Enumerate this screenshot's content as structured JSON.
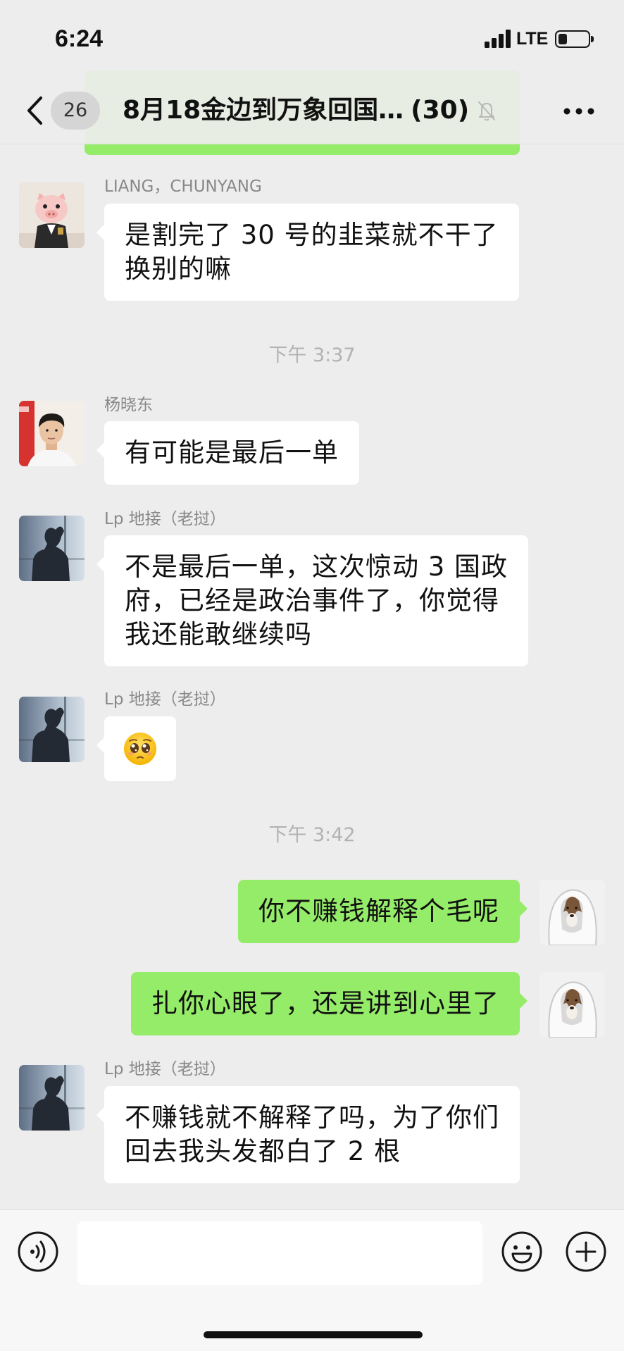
{
  "status_bar": {
    "time": "6:24",
    "network": "LTE",
    "signal_bars": 4,
    "battery_level": 0.3,
    "icons": {
      "signal": "cellular-signal-icon",
      "battery": "battery-icon"
    }
  },
  "nav": {
    "unread_count": "26",
    "title": "8月18金边到万象回国…",
    "member_count": "(30)",
    "icons": {
      "back": "chevron-left-icon",
      "mute": "bell-slash-icon",
      "more": "more-dots-icon"
    }
  },
  "chat": {
    "items": [
      {
        "type": "message",
        "direction": "incoming",
        "sender": "LIANG，CHUNYANG",
        "lines": [
          "是割完了 30 号的韭菜就不干了",
          "换别的嘛"
        ]
      },
      {
        "type": "timestamp",
        "text": "下午 3:37"
      },
      {
        "type": "message",
        "direction": "incoming",
        "sender": "杨晓东",
        "lines": [
          "有可能是最后一单"
        ]
      },
      {
        "type": "message",
        "direction": "incoming",
        "sender": "Lp 地接（老挝）",
        "lines": [
          "不是最后一单，这次惊动 3 国政",
          "府，已经是政治事件了，你觉得",
          "我还能敢继续吗"
        ]
      },
      {
        "type": "message",
        "direction": "incoming",
        "sender": "Lp 地接（老挝）",
        "emoji": "pleading-face-icon"
      },
      {
        "type": "timestamp",
        "text": "下午 3:42"
      },
      {
        "type": "message",
        "direction": "outgoing",
        "lines": [
          "你不赚钱解释个毛呢"
        ]
      },
      {
        "type": "message",
        "direction": "outgoing",
        "lines": [
          "扎你心眼了，还是讲到心里了"
        ]
      },
      {
        "type": "message",
        "direction": "incoming",
        "sender": "Lp 地接（老挝）",
        "lines": [
          "不赚钱就不解释了吗，为了你们",
          "回去我头发都白了 2 根"
        ]
      }
    ]
  },
  "input_bar": {
    "value": "",
    "icons": {
      "voice": "voice-input-icon",
      "emoji": "emoji-icon",
      "more": "plus-circle-icon"
    }
  },
  "colors": {
    "background": "#ededed",
    "incoming_bubble": "#ffffff",
    "outgoing_bubble": "#95ec69",
    "timestamp": "#b2b2b2",
    "sender_name": "#888888",
    "badge": "#d5d5d5"
  }
}
